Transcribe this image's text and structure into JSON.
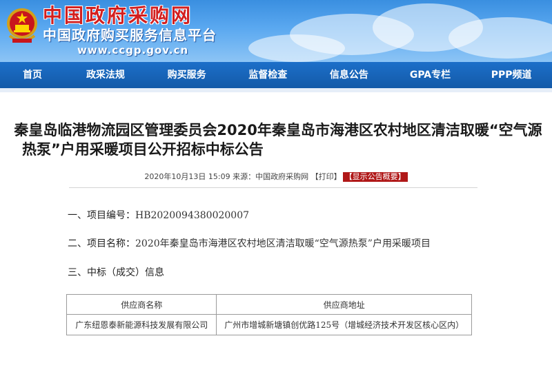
{
  "site": {
    "title": "中国政府采购网",
    "subtitle": "中国政府购买服务信息平台",
    "url": "www.ccgp.gov.cn"
  },
  "nav": {
    "items": [
      {
        "label": "首页"
      },
      {
        "label": "政采法规"
      },
      {
        "label": "购买服务"
      },
      {
        "label": "监督检查"
      },
      {
        "label": "信息公告"
      },
      {
        "label": "GPA专栏"
      },
      {
        "label": "PPP频道"
      }
    ]
  },
  "article": {
    "title_line1": "秦皇岛临港物流园区管理委员会2020年秦皇岛市海港区农村地区清洁取暖“空气源",
    "title_line2": "热泵”户用采暖项目公开招标中标公告",
    "meta_date": "2020年10月13日 15:09 来源：中国政府采购网 【打印】",
    "meta_abstract": "【显示公告概要】",
    "sections": {
      "number_label": "一、项目编号：",
      "number_value": "HB2020094380020007",
      "name_label": "二、项目名称：",
      "name_value": "2020年秦皇岛市海港区农村地区清洁取暖“空气源热泵”户用采暖项目",
      "winner_label": "三、中标（成交）信息"
    },
    "table": {
      "headers": [
        "供应商名称",
        "供应商地址"
      ],
      "rows": [
        [
          "广东纽恩泰新能源科技发展有限公司",
          "广州市增城新塘镇创优路125号（增城经济技术开发区核心区内）"
        ]
      ]
    }
  }
}
